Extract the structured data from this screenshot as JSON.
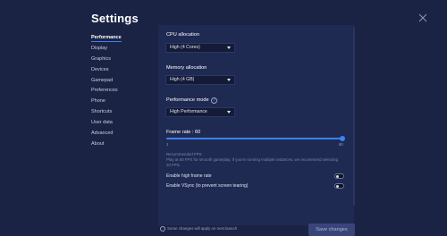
{
  "title": "Settings",
  "nav": [
    {
      "label": "Performance",
      "active": true
    },
    {
      "label": "Display"
    },
    {
      "label": "Graphics"
    },
    {
      "label": "Devices"
    },
    {
      "label": "Gamepad"
    },
    {
      "label": "Preferences"
    },
    {
      "label": "Phone"
    },
    {
      "label": "Shortcuts"
    },
    {
      "label": "User data"
    },
    {
      "label": "Advanced"
    },
    {
      "label": "About"
    }
  ],
  "cpu": {
    "label": "CPU allocation",
    "value": "High (4 Cores)"
  },
  "memory": {
    "label": "Memory allocation",
    "value": "High (4 GB)"
  },
  "performance_mode": {
    "label": "Performance mode",
    "info": "?",
    "value": "High Performance"
  },
  "frame_rate": {
    "label": "Frame rate : 60",
    "min": "1",
    "max": "60",
    "value": 60,
    "recommended_title": "Recommended FPS",
    "recommended_text": "Play at 60 FPS for smooth gameplay. If you're running multiple instances, we recommend selecting 20 FPS."
  },
  "toggles": [
    {
      "label": "Enable high frame rate",
      "on": false
    },
    {
      "label": "Enable VSync (to prevent screen tearing)",
      "on": false
    }
  ],
  "footer": {
    "note": "Some changes will apply on next launch",
    "save_label": "Save changes"
  },
  "colors": {
    "accent": "#3b82f6",
    "background": "#1b2345",
    "panel": "#1f2a52"
  }
}
